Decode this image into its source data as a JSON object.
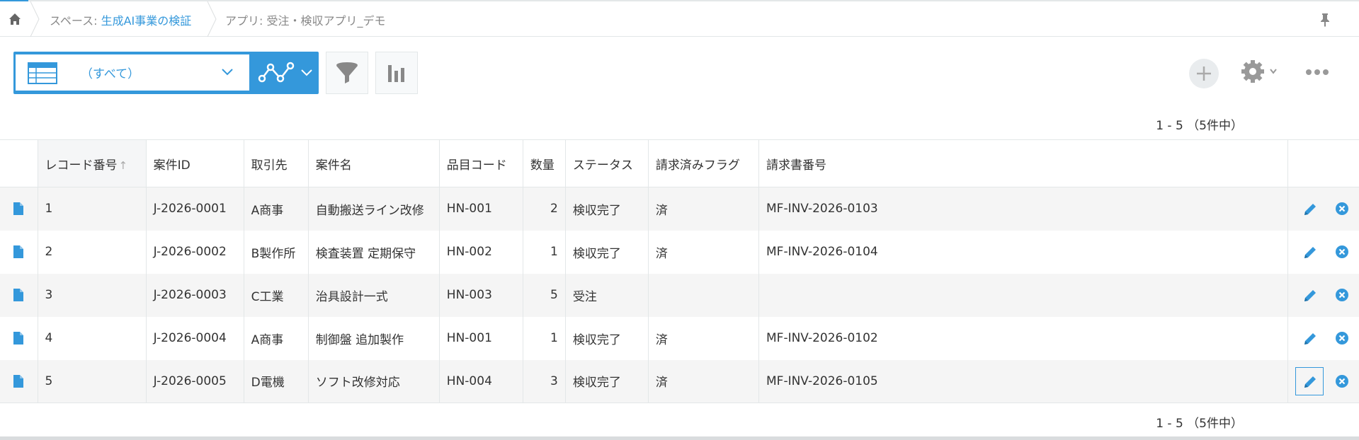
{
  "breadcrumb": {
    "space_prefix": "スペース: ",
    "space_name": "生成AI事業の検証",
    "app": "アプリ: 受注・検収アプリ_デモ"
  },
  "toolbar": {
    "view_label": "（すべて）",
    "accent_color": "#3498db"
  },
  "pager": {
    "top": "1 - 5 （5件中）",
    "bottom": "1 - 5 （5件中）"
  },
  "table": {
    "headers": [
      "レコード番号",
      "案件ID",
      "取引先",
      "案件名",
      "品目コード",
      "数量",
      "ステータス",
      "請求済みフラグ",
      "請求書番号"
    ],
    "sort_arrow": "↑",
    "rows": [
      [
        "1",
        "J-2026-0001",
        "A商事",
        "自動搬送ライン改修",
        "HN-001",
        "2",
        "検収完了",
        "済",
        "MF-INV-2026-0103"
      ],
      [
        "2",
        "J-2026-0002",
        "B製作所",
        "検査装置 定期保守",
        "HN-002",
        "1",
        "検収完了",
        "済",
        "MF-INV-2026-0104"
      ],
      [
        "3",
        "J-2026-0003",
        "C工業",
        "治具設計一式",
        "HN-003",
        "5",
        "受注",
        "",
        ""
      ],
      [
        "4",
        "J-2026-0004",
        "A商事",
        "制御盤 追加製作",
        "HN-001",
        "1",
        "検収完了",
        "済",
        "MF-INV-2026-0102"
      ],
      [
        "5",
        "J-2026-0005",
        "D電機",
        "ソフト改修対応",
        "HN-004",
        "3",
        "検収完了",
        "済",
        "MF-INV-2026-0105"
      ]
    ]
  }
}
